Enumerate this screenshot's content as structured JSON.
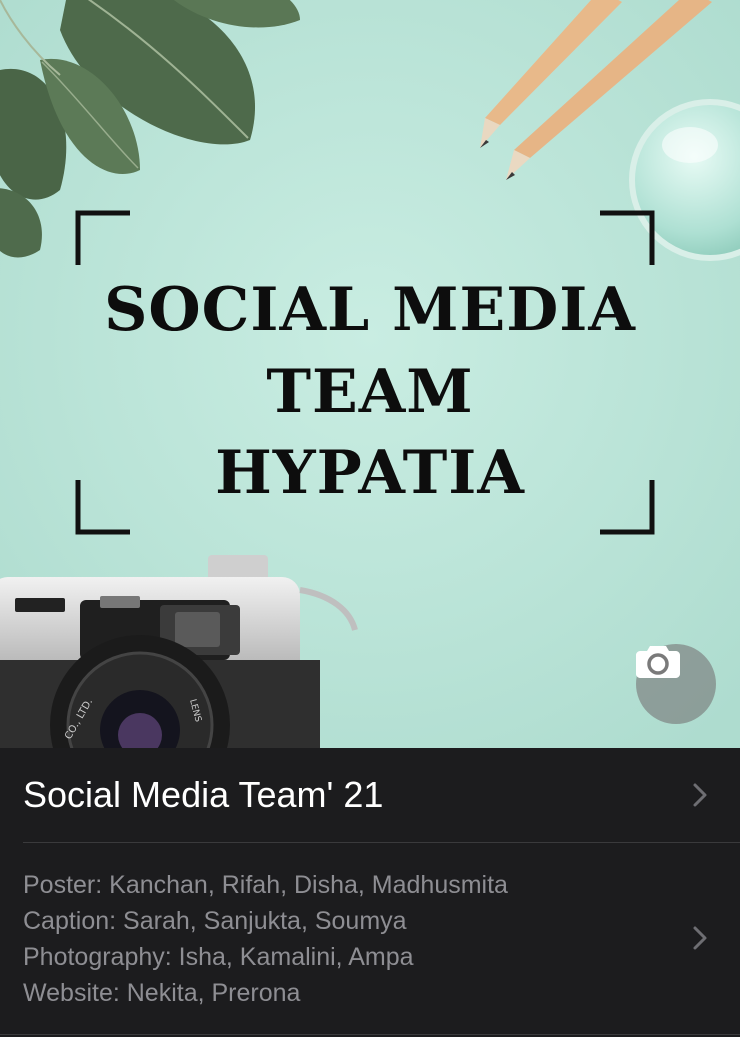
{
  "poster": {
    "line1": "SOCIAL MEDIA",
    "line2": "TEAM",
    "line3": "HYPATIA",
    "lens_text_left": "CO., LTD.",
    "lens_text_right": "LENS"
  },
  "group": {
    "name": "Social Media Team' 21",
    "description": [
      "Poster: Kanchan, Rifah, Disha, Madhusmita",
      "Caption: Sarah, Sanjukta, Soumya",
      "Photography: Isha, Kamalini, Ampa",
      "Website: Nekita, Prerona"
    ]
  },
  "icons": {
    "camera_button": "camera-icon",
    "chevron": "chevron-right-icon"
  },
  "colors": {
    "photo_background": "#bfe6da",
    "panel_background": "#1c1c1e",
    "title_text": "#ffffff",
    "secondary_text": "#8e8e93"
  }
}
